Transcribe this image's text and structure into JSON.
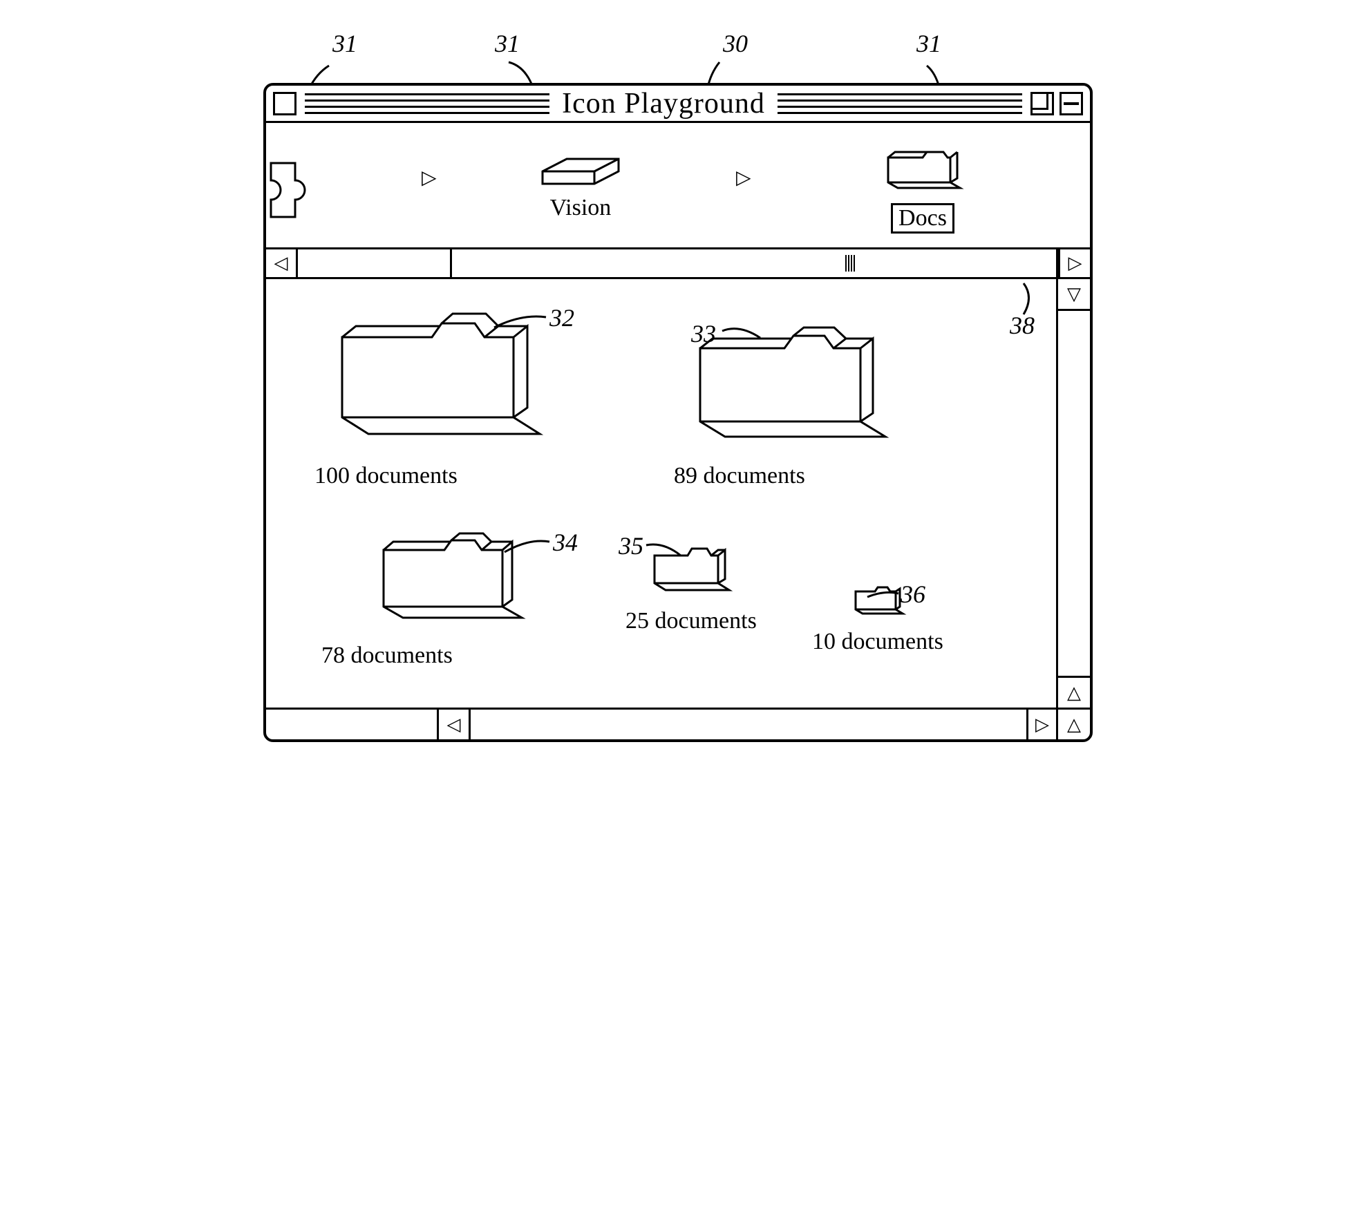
{
  "window": {
    "title": "Icon Playground"
  },
  "path": {
    "items": [
      {
        "label": "Vision",
        "boxed": false
      },
      {
        "label": "Docs",
        "boxed": true
      }
    ]
  },
  "folders": [
    {
      "label": "100 documents",
      "ref": "32"
    },
    {
      "label": "89 documents",
      "ref": "33"
    },
    {
      "label": "78 documents",
      "ref": "34"
    },
    {
      "label": "25 documents",
      "ref": "35"
    },
    {
      "label": "10 documents",
      "ref": "36"
    }
  ],
  "callouts": {
    "c30": "30",
    "c31a": "31",
    "c31b": "31",
    "c31c": "31",
    "c32": "32",
    "c33": "33",
    "c34": "34",
    "c35": "35",
    "c36": "36",
    "c38": "38"
  }
}
